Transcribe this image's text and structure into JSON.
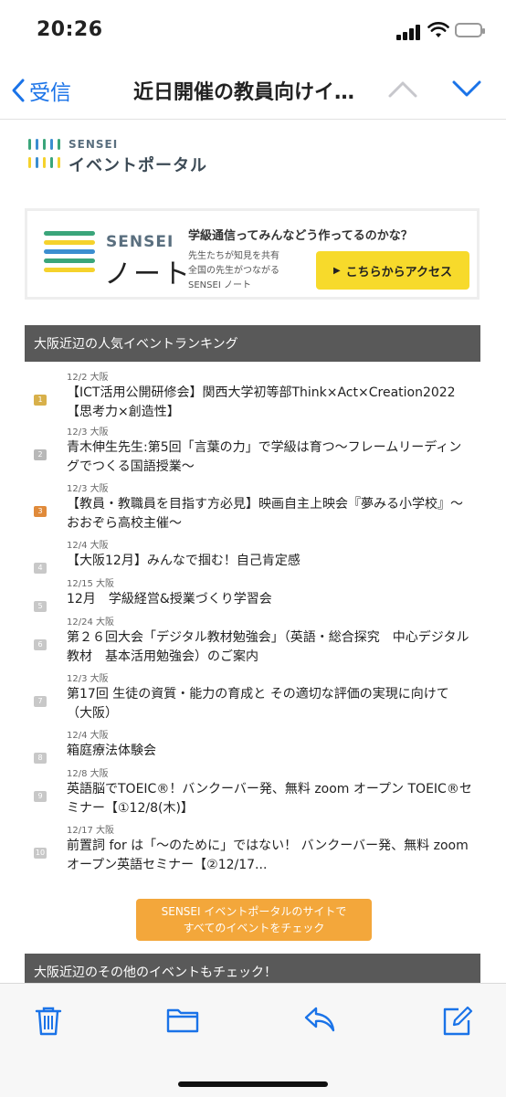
{
  "status": {
    "time": "20:26"
  },
  "nav": {
    "back_label": "受信",
    "title": "近日開催の教員向けイ…"
  },
  "logo": {
    "brand": "SENSEI",
    "name": "イベントポータル"
  },
  "banner": {
    "brand": "SENSEI",
    "product": "ノート",
    "headline": "学級通信ってみんなどう作ってるのかな？",
    "sub_lines": [
      "先生たちが知見を共有",
      "全国の先生がつながる",
      "SENSEI ノート"
    ],
    "button_label": "こちらからアクセス"
  },
  "ranking": {
    "header": "大阪近辺の人気イベントランキング",
    "items": [
      {
        "rank": "1",
        "date": "12/2",
        "area": "大阪",
        "title": "【ICT活用公開研修会】関西大学初等部Think×Act×Creation2022【思考力×創造性】"
      },
      {
        "rank": "2",
        "date": "12/3",
        "area": "大阪",
        "title": "青木伸生先生:第5回「言葉の力」で学級は育つ〜フレームリーディングでつくる国語授業〜"
      },
      {
        "rank": "3",
        "date": "12/3",
        "area": "大阪",
        "title": "【教員・教職員を目指す方必見】映画自主上映会『夢みる小学校』〜おおぞら高校主催〜"
      },
      {
        "rank": "4",
        "date": "12/4",
        "area": "大阪",
        "title": "【大阪12月】みんなで掴む！自己肯定感"
      },
      {
        "rank": "5",
        "date": "12/15",
        "area": "大阪",
        "title": "12月　学級経営&授業づくり学習会"
      },
      {
        "rank": "6",
        "date": "12/24",
        "area": "大阪",
        "title": "第２６回大会「デジタル教材勉強会」（英語・総合探究　中心デジタル教材　基本活用勉強会）のご案内"
      },
      {
        "rank": "7",
        "date": "12/3",
        "area": "大阪",
        "title": "第17回 生徒の資質・能力の育成と その適切な評価の実現に向けて（大阪）"
      },
      {
        "rank": "8",
        "date": "12/4",
        "area": "大阪",
        "title": "箱庭療法体験会"
      },
      {
        "rank": "9",
        "date": "12/8",
        "area": "大阪",
        "title": "英語脳でTOEIC®！バンクーバー発、無料 zoom オープン TOEIC®セミナー【①12/8(木)】"
      },
      {
        "rank": "10",
        "date": "12/17",
        "area": "大阪",
        "title": "前置詞 for は「〜のために」ではない！ バンクーバー発、無料 zoom オープン英語セミナー【②12/17..."
      }
    ]
  },
  "cta": {
    "line1": "SENSEI イベントポータルのサイトで",
    "line2": "すべてのイベントをチェック"
  },
  "other_section": {
    "header": "大阪近辺のその他のイベントもチェック！"
  },
  "toolbar": {
    "icons": [
      "trash-icon",
      "folder-icon",
      "reply-icon",
      "compose-icon"
    ]
  },
  "colors": {
    "accent": "#1a73e8",
    "cta": "#f3a73b",
    "banner_button": "#f7da2b",
    "section_bar": "#595959"
  }
}
